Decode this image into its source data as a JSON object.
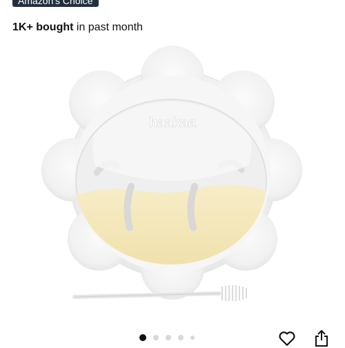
{
  "badge": {
    "label": "Amazon's Choice"
  },
  "purchase_info": {
    "count": "1K+ bought",
    "suffix": " in past month"
  },
  "product_image": {
    "brand_text": "haakaa",
    "alt": "haakaa"
  },
  "carousel": {
    "dots": 5,
    "active_index": 0
  },
  "actions": {
    "wishlist_icon": "heart-icon",
    "share_icon": "share-icon"
  },
  "colors": {
    "badge_bg": "#232f3e",
    "text": "#0f1111",
    "milk": "#f3e6b8",
    "dot_inactive": "#d5d9d9"
  }
}
